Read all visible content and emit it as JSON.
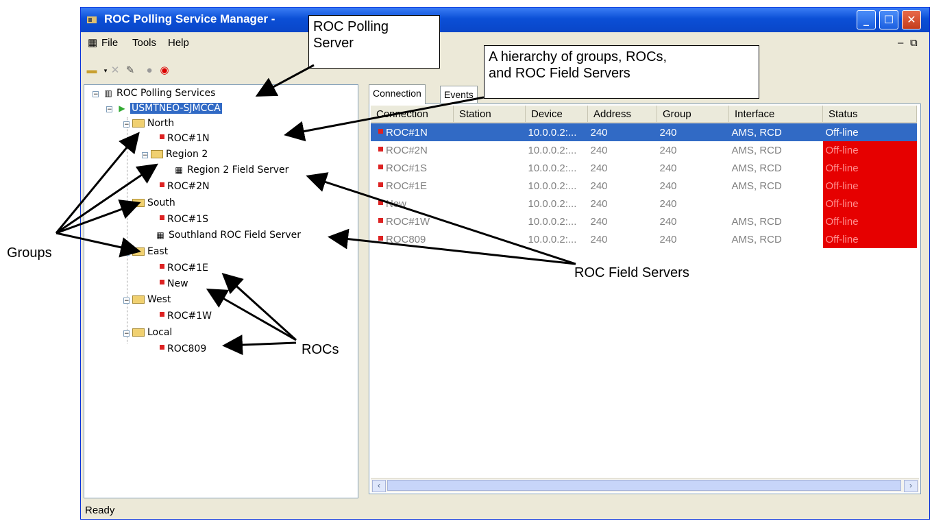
{
  "window": {
    "title": "ROC Polling Service Manager -"
  },
  "menu": [
    "File",
    "Tools",
    "Help"
  ],
  "tree": {
    "root": "ROC Polling Services",
    "server": "USMTNEO-SJMCCA",
    "nodes": [
      {
        "label": "North",
        "type": "folder"
      },
      {
        "label": "ROC#1N",
        "type": "roc"
      },
      {
        "label": "Region 2",
        "type": "folder"
      },
      {
        "label": "Region 2 Field Server",
        "type": "fieldserver"
      },
      {
        "label": "ROC#2N",
        "type": "roc"
      },
      {
        "label": "South",
        "type": "folder"
      },
      {
        "label": "ROC#1S",
        "type": "roc"
      },
      {
        "label": "Southland ROC Field Server",
        "type": "fieldserver"
      },
      {
        "label": "East",
        "type": "folder"
      },
      {
        "label": "ROC#1E",
        "type": "roc"
      },
      {
        "label": "New",
        "type": "roc"
      },
      {
        "label": "West",
        "type": "folder"
      },
      {
        "label": "ROC#1W",
        "type": "roc"
      },
      {
        "label": "Local",
        "type": "folder"
      },
      {
        "label": "ROC809",
        "type": "roc"
      }
    ]
  },
  "tabs": [
    "Connection",
    "Events"
  ],
  "table": {
    "columns": [
      "Connection",
      "Station",
      "Device",
      "Address",
      "Group",
      "Interface",
      "Status"
    ],
    "rows": [
      [
        "ROC#1N",
        "",
        "10.0.0.2:...",
        "240",
        "240",
        "AMS, RCD",
        "Off-line"
      ],
      [
        "ROC#2N",
        "",
        "10.0.0.2:...",
        "240",
        "240",
        "AMS, RCD",
        "Off-line"
      ],
      [
        "ROC#1S",
        "",
        "10.0.0.2:...",
        "240",
        "240",
        "AMS, RCD",
        "Off-line"
      ],
      [
        "ROC#1E",
        "",
        "10.0.0.2:...",
        "240",
        "240",
        "AMS, RCD",
        "Off-line"
      ],
      [
        "New",
        "",
        "10.0.0.2:...",
        "240",
        "240",
        "",
        "Off-line"
      ],
      [
        "ROC#1W",
        "",
        "10.0.0.2:...",
        "240",
        "240",
        "AMS, RCD",
        "Off-line"
      ],
      [
        "ROC809",
        "",
        "10.0.0.2:...",
        "240",
        "240",
        "AMS, RCD",
        "Off-line"
      ]
    ]
  },
  "status": "Ready",
  "callouts": {
    "server_line1": "ROC Polling",
    "server_line2": "Server",
    "hierarchy_line1": "A hierarchy of groups, ROCs,",
    "hierarchy_line2": "and ROC Field Servers",
    "groups": "Groups",
    "field_servers": "ROC Field Servers",
    "rocs": "ROCs"
  }
}
